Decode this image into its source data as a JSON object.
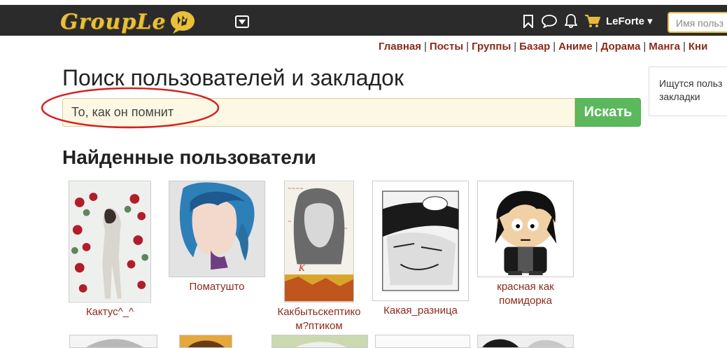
{
  "header": {
    "logo_text": "GroupLe",
    "user_name": "LeForte ▾",
    "search_placeholder": "Имя польз"
  },
  "nav": {
    "items": [
      "Главная",
      "Посты",
      "Группы",
      "Базар",
      "Аниме",
      "Дорама",
      "Манга",
      "Кни"
    ]
  },
  "page": {
    "title": "Поиск пользователей и закладок",
    "search_value": "То, как он помнит",
    "search_button": "Искать",
    "side_box_text": "Ищутся польз закладки",
    "found_users_title": "Найденные пользователи"
  },
  "users": [
    {
      "name": "Кактус^_^"
    },
    {
      "name": "Поматушто"
    },
    {
      "name": "Какбытьскептико м?птиком"
    },
    {
      "name": "Какая_разница"
    },
    {
      "name": "красная как помидорка"
    }
  ],
  "colors": {
    "header_bg": "#2b2b2b",
    "logo": "#e8c03a",
    "link": "#8c2a1a",
    "search_button": "#5cb85c",
    "annotation": "#d42020"
  }
}
